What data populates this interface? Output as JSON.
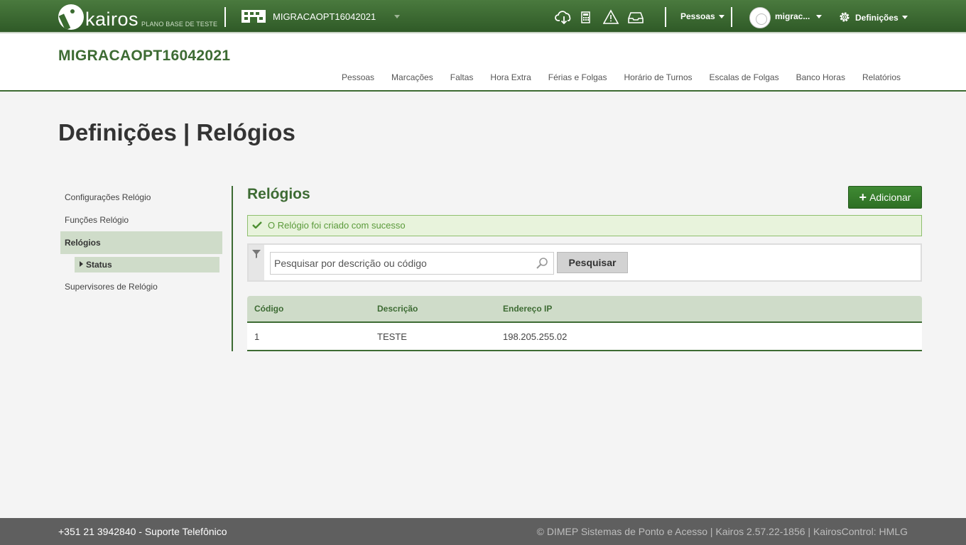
{
  "topbar": {
    "logo_text": "kairos",
    "logo_sub": "PLANO BASE DE TESTE",
    "company": "MIGRACAOPT16042021",
    "pessoas_menu": "Pessoas",
    "user_menu": "migrac...",
    "settings_menu": "Definições",
    "icons": [
      "cloud-download-icon",
      "calculator-icon",
      "warning-icon",
      "inbox-icon",
      "gear-icon"
    ]
  },
  "header": {
    "title": "MIGRACAOPT16042021",
    "nav": [
      "Pessoas",
      "Marcações",
      "Faltas",
      "Hora Extra",
      "Férias e Folgas",
      "Horário de Turnos",
      "Escalas de Folgas",
      "Banco Horas",
      "Relatórios"
    ]
  },
  "page": {
    "title": "Definições | Relógios"
  },
  "sidebar": {
    "items": [
      {
        "label": "Configurações Relógio"
      },
      {
        "label": "Funções Relógio"
      },
      {
        "label": "Relógios"
      },
      {
        "label": "Status"
      },
      {
        "label": "Supervisores de Relógio"
      }
    ]
  },
  "content": {
    "title": "Relógios",
    "add_label": "Adicionar",
    "add_symbol": "+",
    "alert": "O Relógio foi criado com sucesso",
    "search_placeholder": "Pesquisar por descrição ou código",
    "search_button": "Pesquisar",
    "table": {
      "headers": [
        "Código",
        "Descrição",
        "Endereço IP"
      ],
      "rows": [
        [
          "1",
          "TESTE",
          "198.205.255.02"
        ]
      ]
    }
  },
  "footer": {
    "left": "+351 21 3942840 - Suporte Telefônico",
    "right": "© DIMEP Sistemas de Ponto e Acesso | Kairos 2.57.22-1856 | KairosControl: HMLG"
  },
  "colors": {
    "brand_green": "#3d6b33",
    "topbar_green": "#3a6b30",
    "highlight": "#cfdcc9",
    "success_bg": "#e8f3dc"
  }
}
